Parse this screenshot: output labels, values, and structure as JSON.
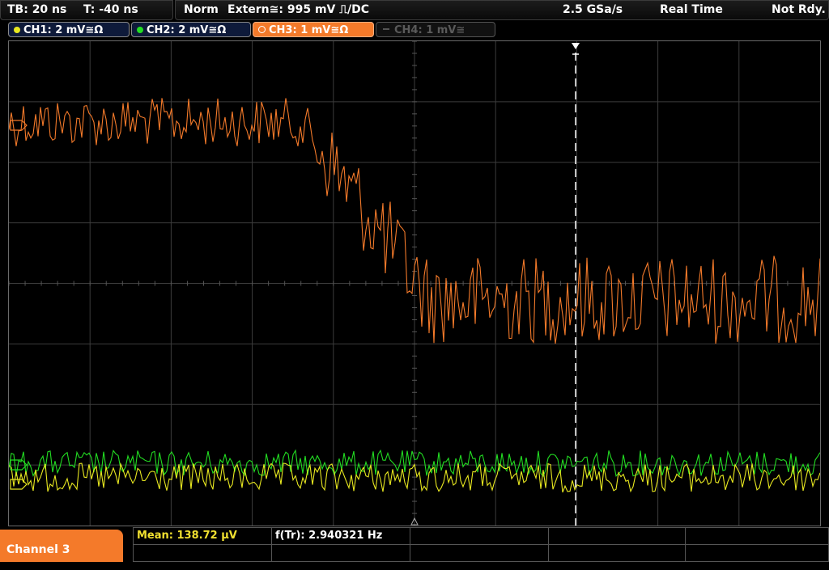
{
  "status": {
    "timebase": "TB: 20 ns",
    "trigger_time": "T: -40 ns",
    "trigger_mode": "Norm",
    "trigger_source": "Extern≅: 995 mV ⎍/DC",
    "sample_rate": "2.5 GSa/s",
    "acq_mode": "Real Time",
    "ready_state": "Not Rdy."
  },
  "channels": [
    {
      "label": "CH1: 2 mV≅Ω",
      "color": "#e8e820",
      "active": false
    },
    {
      "label": "CH2: 2 mV≅Ω",
      "color": "#22dd22",
      "active": false
    },
    {
      "label": "CH3: 1 mV≅Ω",
      "color": "#f47a2a",
      "active": true
    },
    {
      "label": "CH4: 1 mV≅",
      "color": "#666666",
      "active": false
    }
  ],
  "bottom": {
    "channel_label": "Channel 3",
    "mean": "Mean: 138.72 µV",
    "freq": "f(Tr): 2.940321 Hz"
  },
  "colors": {
    "ch1": "#e8e820",
    "ch2": "#22dd22",
    "ch3": "#f47a2a",
    "grid": "#3c3c3c",
    "trigger_marker": "#ffffff"
  }
}
